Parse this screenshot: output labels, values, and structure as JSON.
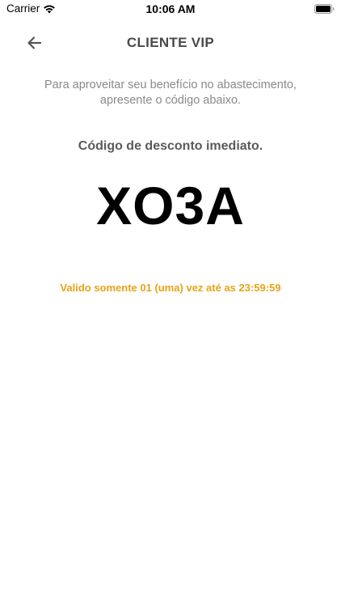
{
  "status_bar": {
    "carrier": "Carrier",
    "time": "10:06 AM",
    "icons": [
      "wifi-icon",
      "battery-icon"
    ]
  },
  "header": {
    "title": "CLIENTE VIP",
    "back_icon": "arrow-left-icon"
  },
  "main": {
    "instruction_line1": "Para aproveitar seu benefício no abastecimento,",
    "instruction_line2": "apresente o código abaixo.",
    "code_heading": "Código de desconto imediato.",
    "code": "XO3A",
    "validity": "Valido somente 01 (uma) vez até as 23:59:59"
  },
  "colors": {
    "title": "#4a4a4a",
    "instructions": "#8a8a8a",
    "code": "#000000",
    "validity": "#e8a317"
  }
}
